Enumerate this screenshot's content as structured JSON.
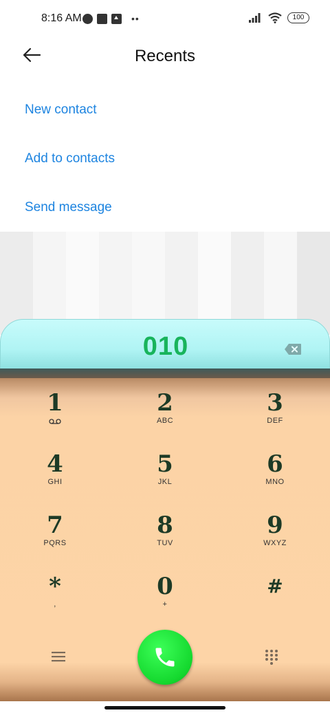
{
  "status_bar": {
    "time": "8:16 AM",
    "battery": "100",
    "icons": [
      "signal-icon",
      "wifi-icon",
      "battery-icon"
    ]
  },
  "header": {
    "title": "Recents",
    "back_icon": "arrow-left-icon"
  },
  "menu": {
    "items": [
      "New contact",
      "Add to contacts",
      "Send message"
    ],
    "link_color": "#1d84e0"
  },
  "dialer": {
    "number": "010",
    "number_color": "#18b45c",
    "keys": [
      {
        "digit": "1",
        "letters": ""
      },
      {
        "digit": "2",
        "letters": "ABC"
      },
      {
        "digit": "3",
        "letters": "DEF"
      },
      {
        "digit": "4",
        "letters": "GHI"
      },
      {
        "digit": "5",
        "letters": "JKL"
      },
      {
        "digit": "6",
        "letters": "MNO"
      },
      {
        "digit": "7",
        "letters": "PQRS"
      },
      {
        "digit": "8",
        "letters": "TUV"
      },
      {
        "digit": "9",
        "letters": "WXYZ"
      },
      {
        "digit": "*",
        "letters": ","
      },
      {
        "digit": "0",
        "letters": "+"
      },
      {
        "digit": "#",
        "letters": ""
      }
    ],
    "call_color": "#14d82e"
  }
}
